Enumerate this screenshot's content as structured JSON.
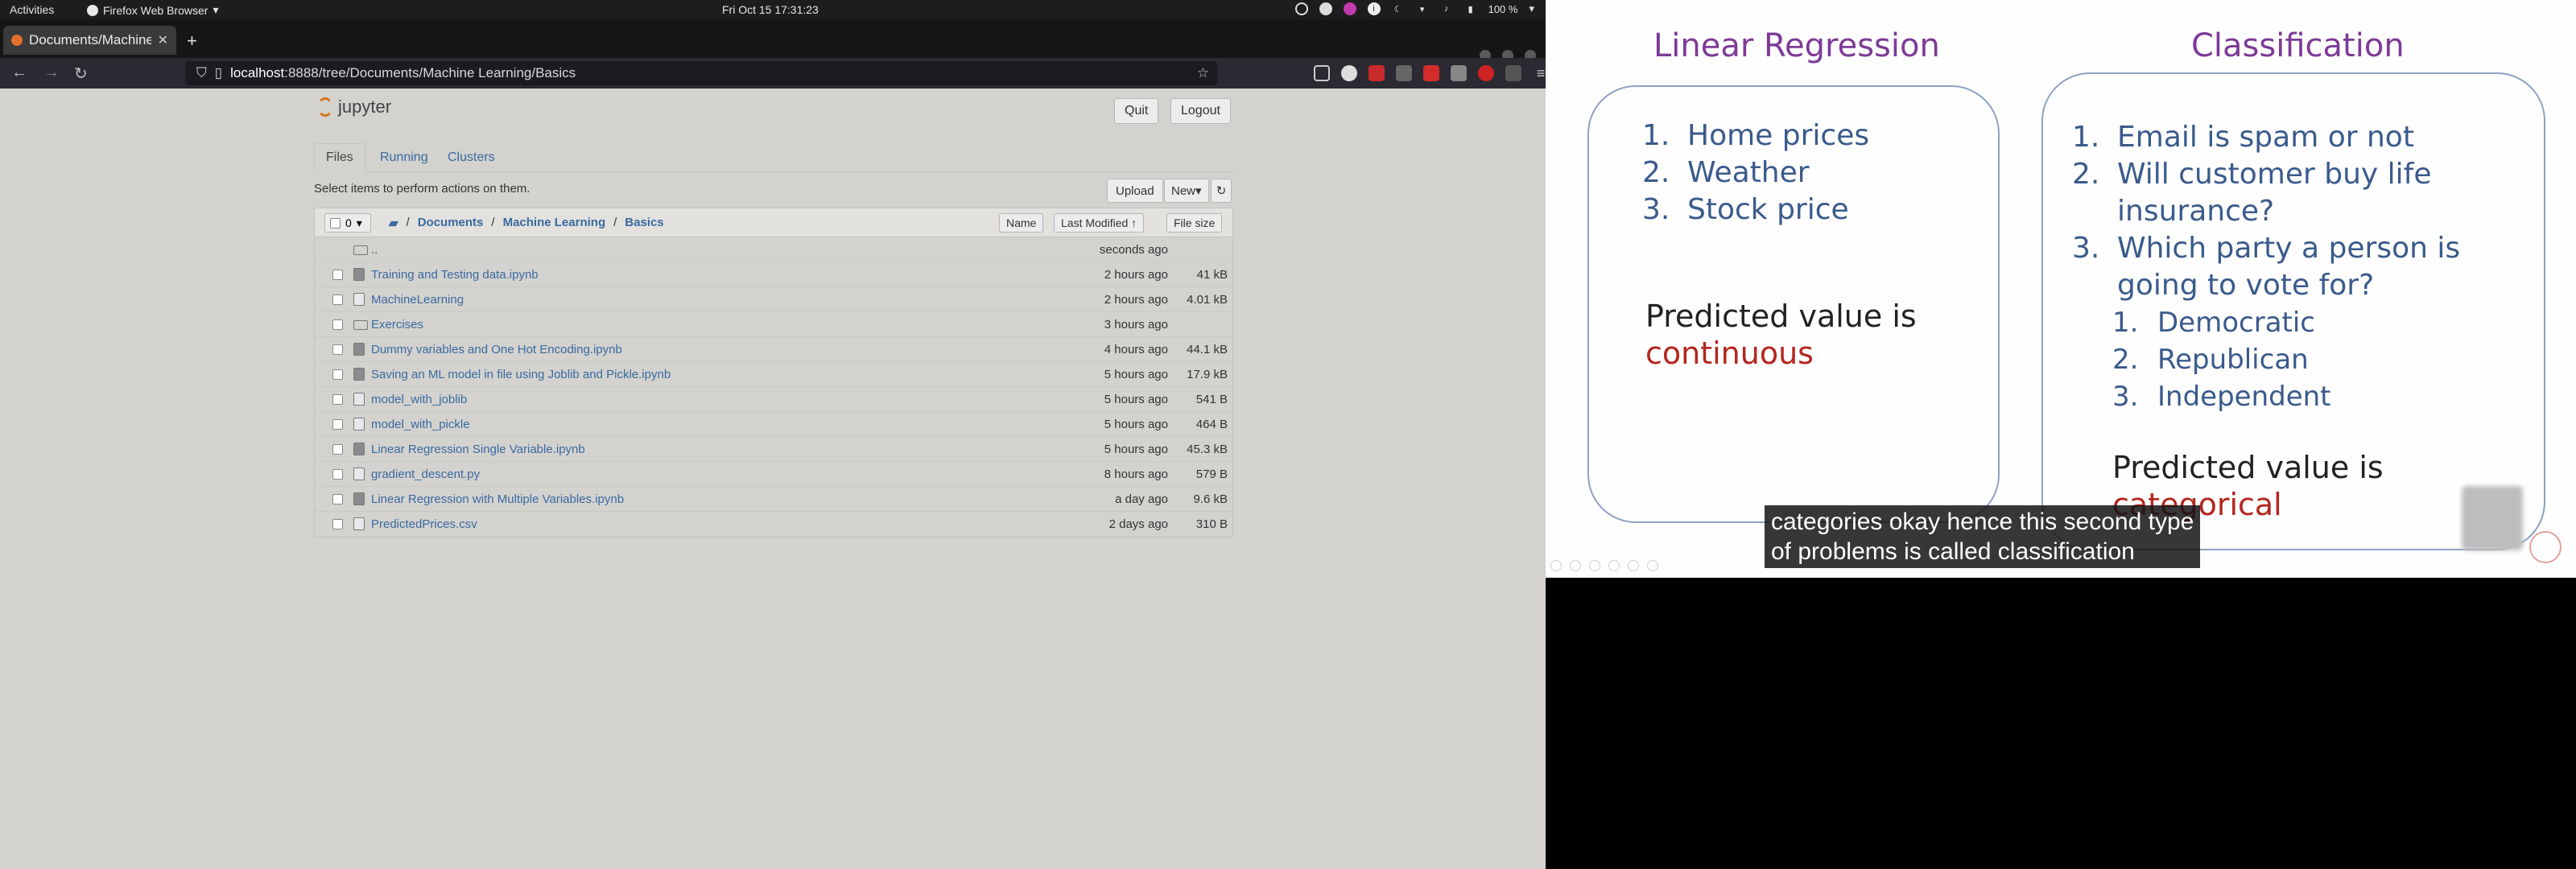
{
  "system": {
    "activities": "Activities",
    "app_name": "Firefox Web Browser",
    "clock": "Fri Oct 15  17:31:23",
    "battery": "100 %"
  },
  "browser": {
    "tab_title": "Documents/Machine",
    "url_scheme_host": "localhost",
    "url_rest": ":8888/tree/Documents/Machine Learning/Basics"
  },
  "jupyter": {
    "logo_text": "jupyter",
    "quit": "Quit",
    "logout": "Logout",
    "tabs": [
      "Files",
      "Running",
      "Clusters"
    ],
    "hint": "Select items to perform actions on them.",
    "upload": "Upload",
    "new": "New",
    "selected_count": "0",
    "breadcrumb": [
      "Documents",
      "Machine Learning",
      "Basics"
    ],
    "col_name": "Name",
    "col_modified": "Last Modified",
    "col_size": "File size",
    "files": [
      {
        "name": "..",
        "modified": "seconds ago",
        "size": "",
        "kind": "up"
      },
      {
        "name": "Training and Testing data.ipynb",
        "modified": "2 hours ago",
        "size": "41 kB",
        "kind": "nb"
      },
      {
        "name": "MachineLearning",
        "modified": "2 hours ago",
        "size": "4.01 kB",
        "kind": "file"
      },
      {
        "name": "Exercises",
        "modified": "3 hours ago",
        "size": "",
        "kind": "folder"
      },
      {
        "name": "Dummy variables and One Hot Encoding.ipynb",
        "modified": "4 hours ago",
        "size": "44.1 kB",
        "kind": "nb"
      },
      {
        "name": "Saving an ML model in file using Joblib and Pickle.ipynb",
        "modified": "5 hours ago",
        "size": "17.9 kB",
        "kind": "nb"
      },
      {
        "name": "model_with_joblib",
        "modified": "5 hours ago",
        "size": "541 B",
        "kind": "file"
      },
      {
        "name": "model_with_pickle",
        "modified": "5 hours ago",
        "size": "464 B",
        "kind": "file"
      },
      {
        "name": "Linear Regression Single Variable.ipynb",
        "modified": "5 hours ago",
        "size": "45.3 kB",
        "kind": "nb"
      },
      {
        "name": "gradient_descent.py",
        "modified": "8 hours ago",
        "size": "579 B",
        "kind": "file"
      },
      {
        "name": "Linear Regression with Multiple Variables.ipynb",
        "modified": "a day ago",
        "size": "9.6 kB",
        "kind": "nb"
      },
      {
        "name": "PredictedPrices.csv",
        "modified": "2 days ago",
        "size": "310 B",
        "kind": "file"
      }
    ]
  },
  "slide": {
    "left_title": "Linear Regression",
    "right_title": "Classification",
    "left_items": [
      "Home prices",
      "Weather",
      "Stock price"
    ],
    "left_pred_1": "Predicted value is",
    "left_pred_2": "continuous",
    "right_items": [
      "Email is spam or not",
      "Will customer buy life insurance?",
      "Which party a person is going to vote for?"
    ],
    "right_subitems": [
      "Democratic",
      "Republican",
      "Independent"
    ],
    "right_pred_1": "Predicted value is",
    "right_pred_2": "categorical",
    "caption_1": "categories okay hence this second type",
    "caption_2": "of problems is called classification",
    "colors": {
      "title": "#7d3a97",
      "list": "#3a5a8c",
      "emphasis": "#b3261e",
      "panel_border": "#8da2c2"
    }
  }
}
